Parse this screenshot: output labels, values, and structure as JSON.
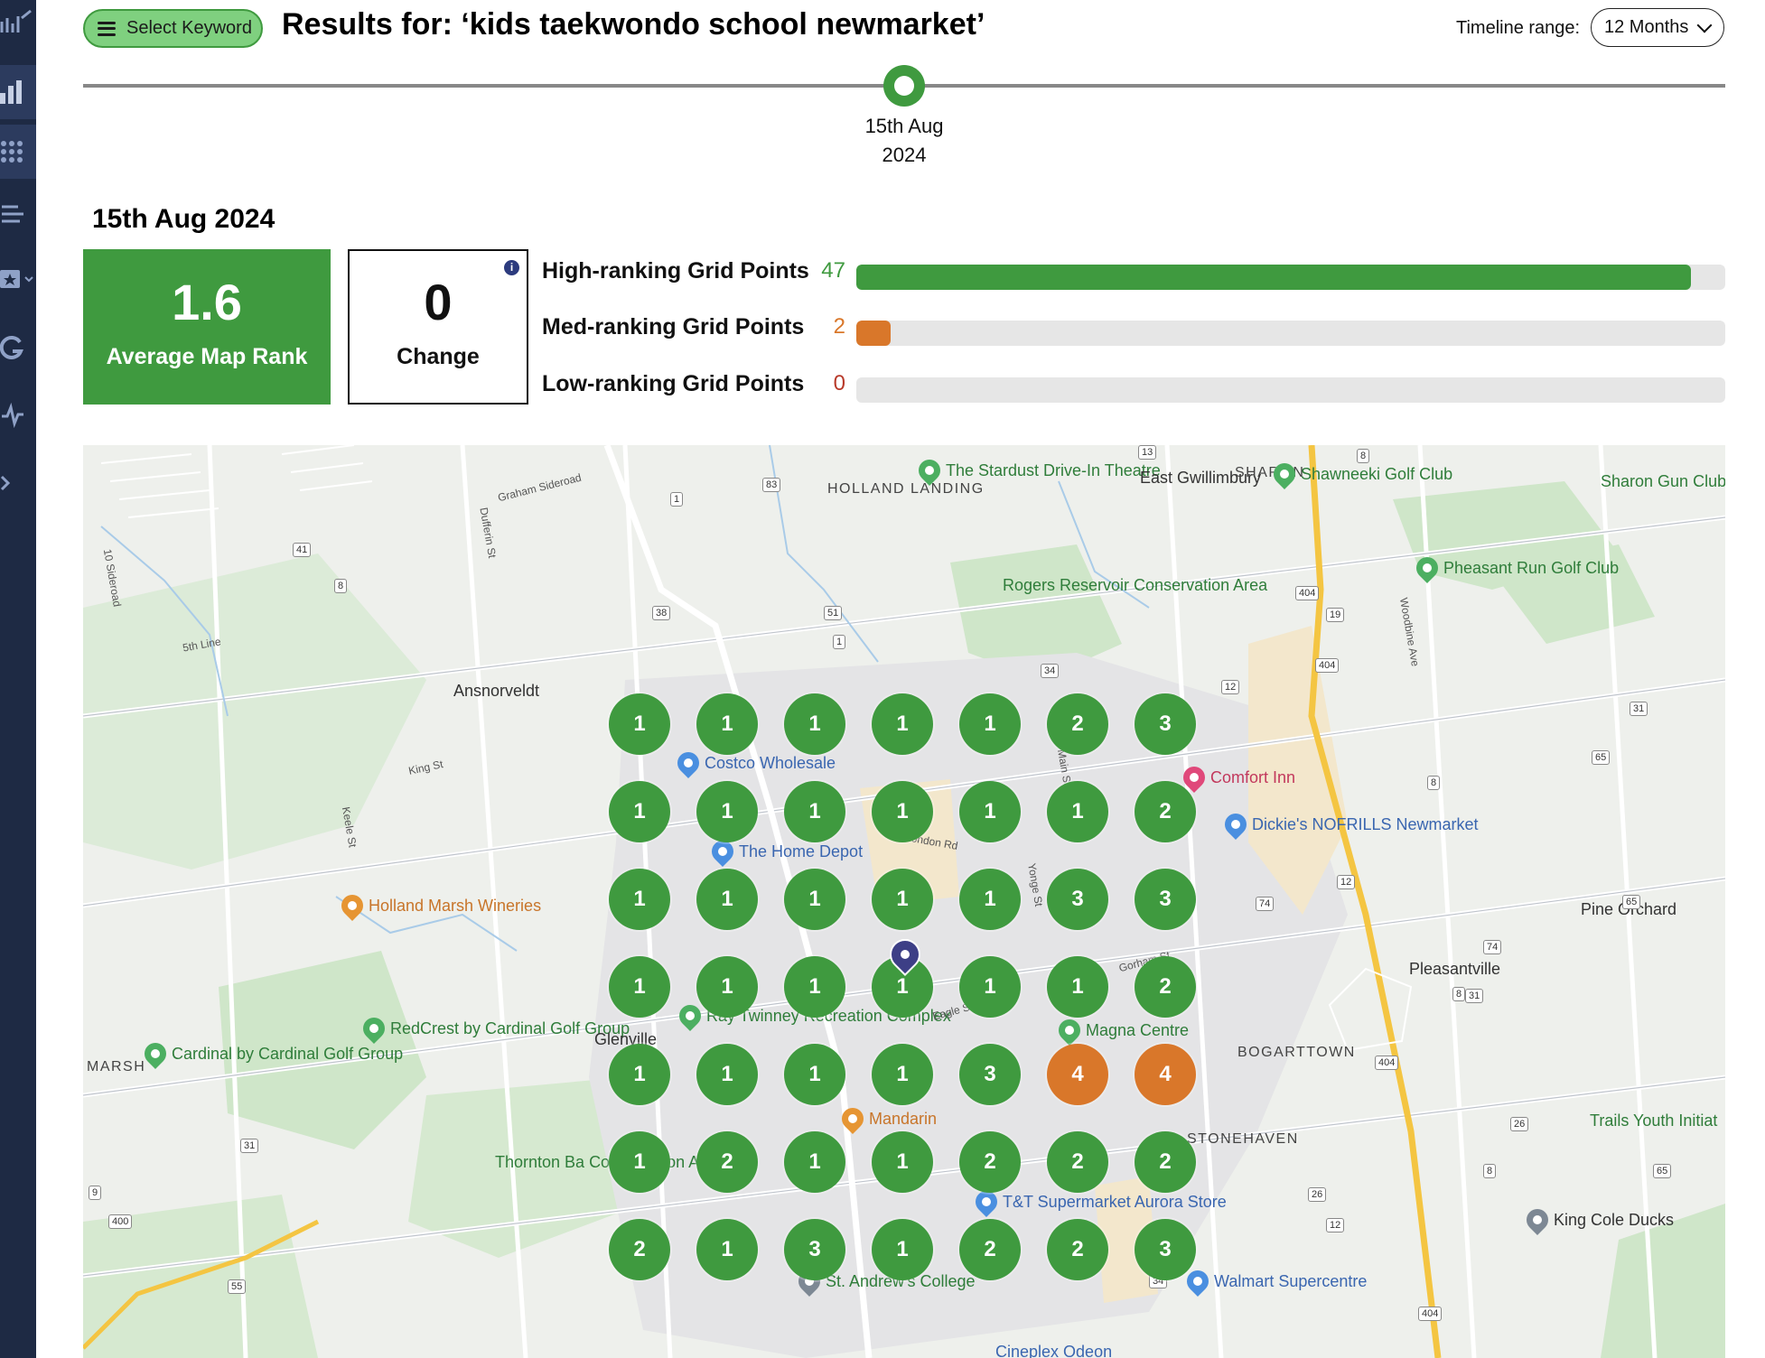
{
  "header": {
    "keyword_button": "Select Keyword",
    "title": "Results for: ‘kids taekwondo school newmarket’",
    "timeline_label": "Timeline range:",
    "timeline_value": "12 Months"
  },
  "timeline": {
    "date_line1": "15th Aug",
    "date_line2": "2024"
  },
  "summary": {
    "date_heading": "15th Aug 2024",
    "average_rank": "1.6",
    "average_rank_label": "Average Map Rank",
    "change": "0",
    "change_label": "Change"
  },
  "ranking_bars": [
    {
      "label": "High-ranking Grid Points",
      "count": "47",
      "fraction": 0.96,
      "color": "#3f9a3f"
    },
    {
      "label": "Med-ranking Grid Points",
      "count": "2",
      "fraction": 0.04,
      "color": "#d9772a"
    },
    {
      "label": "Low-ranking Grid Points",
      "count": "0",
      "fraction": 0.0,
      "color": "#b83a2a"
    }
  ],
  "colors": {
    "high": "#3f9a3f",
    "med": "#d9772a",
    "low": "#b83a2a",
    "rail": "#1e2a44"
  },
  "map": {
    "grid_ranks": [
      [
        "1",
        "1",
        "1",
        "1",
        "1",
        "2",
        "3"
      ],
      [
        "1",
        "1",
        "1",
        "1",
        "1",
        "1",
        "2"
      ],
      [
        "1",
        "1",
        "1",
        "1",
        "1",
        "3",
        "3"
      ],
      [
        "1",
        "1",
        "1",
        "1",
        "1",
        "1",
        "2"
      ],
      [
        "1",
        "1",
        "1",
        "1",
        "3",
        "4",
        "4"
      ],
      [
        "1",
        "2",
        "1",
        "1",
        "2",
        "2",
        "2"
      ],
      [
        "2",
        "1",
        "3",
        "1",
        "2",
        "2",
        "3"
      ]
    ],
    "place_labels": [
      "The Stardust Drive-In Theatre",
      "HOLLAND LANDING",
      "East Gwillimbury",
      "SHARON",
      "Shawneeki Golf Club",
      "Sharon Gun Club",
      "Pheasant Run Golf Club",
      "Rogers Reservoir Conservation Area",
      "Ansnorveldt",
      "Costco Wholesale",
      "Comfort Inn",
      "Dickie's NOFRILLS Newmarket",
      "The Home Depot",
      "Holland Marsh Wineries",
      "Pine Orchard",
      "Pleasantville",
      "RedCrest by Cardinal Golf Group",
      "Cardinal by Cardinal Golf Group",
      "MARSH",
      "Glenville",
      "Ray Twinney Recreation Complex",
      "Magna Centre",
      "BOGARTTOWN",
      "Mandarin",
      "STONEHAVEN",
      "Trails Youth Initiat",
      "Thornton Ba Conservation Ar",
      "T&T Supermarket Aurora Store",
      "King Cole Ducks",
      "St. Andrew's College",
      "Walmart Supercentre",
      "Cineplex Odeon"
    ],
    "road_labels": [
      "Graham Sideroad",
      "Dufferin St",
      "5th Line",
      "King St",
      "Keele St",
      "10 Sideroad",
      "London Rd",
      "Eagle St",
      "Gorham St",
      "Woodbine Ave",
      "Main St",
      "Yonge St"
    ],
    "route_numbers": [
      "13",
      "8",
      "83",
      "1",
      "41",
      "8",
      "38",
      "51",
      "1",
      "34",
      "404",
      "19",
      "12",
      "31",
      "65",
      "8",
      "404",
      "12",
      "74",
      "65",
      "74",
      "8",
      "31",
      "404",
      "26",
      "8",
      "65",
      "26",
      "12",
      "34",
      "55",
      "400",
      "9",
      "31",
      "404"
    ]
  }
}
